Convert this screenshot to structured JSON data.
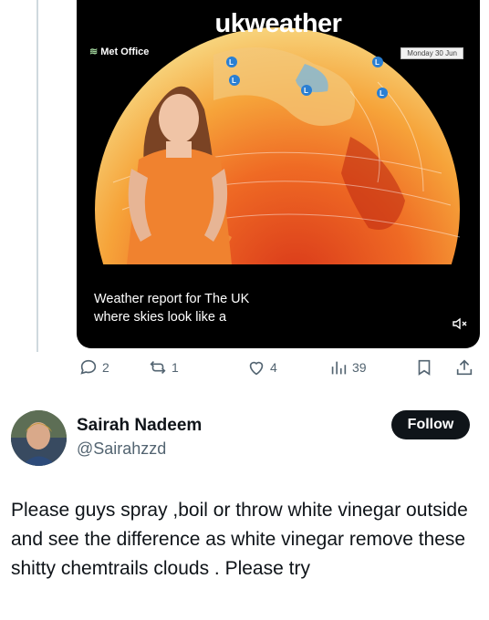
{
  "video": {
    "title": "ukweather",
    "brand": "Met Office",
    "date": "Monday 30 Jun",
    "caption_line1": "Weather report for The UK",
    "caption_line2": "where skies look like a",
    "icons": {
      "mute": "muted-speaker-icon"
    }
  },
  "actions": {
    "replies": "2",
    "reposts": "1",
    "likes": "4",
    "views": "39",
    "icons": [
      "reply-icon",
      "repost-icon",
      "like-icon",
      "views-icon",
      "bookmark-icon",
      "share-icon"
    ]
  },
  "reply": {
    "name": "Sairah Nadeem",
    "handle": "@Sairahzzd",
    "follow_label": "Follow",
    "text": "Please guys spray ,boil or throw white vinegar outside and see the difference as white vinegar remove these shitty chemtrails clouds . Please try"
  },
  "colors": {
    "text": "#0f1419",
    "secondary": "#536471",
    "follow_bg": "#0f1419",
    "thread_line": "#cfd9de"
  }
}
